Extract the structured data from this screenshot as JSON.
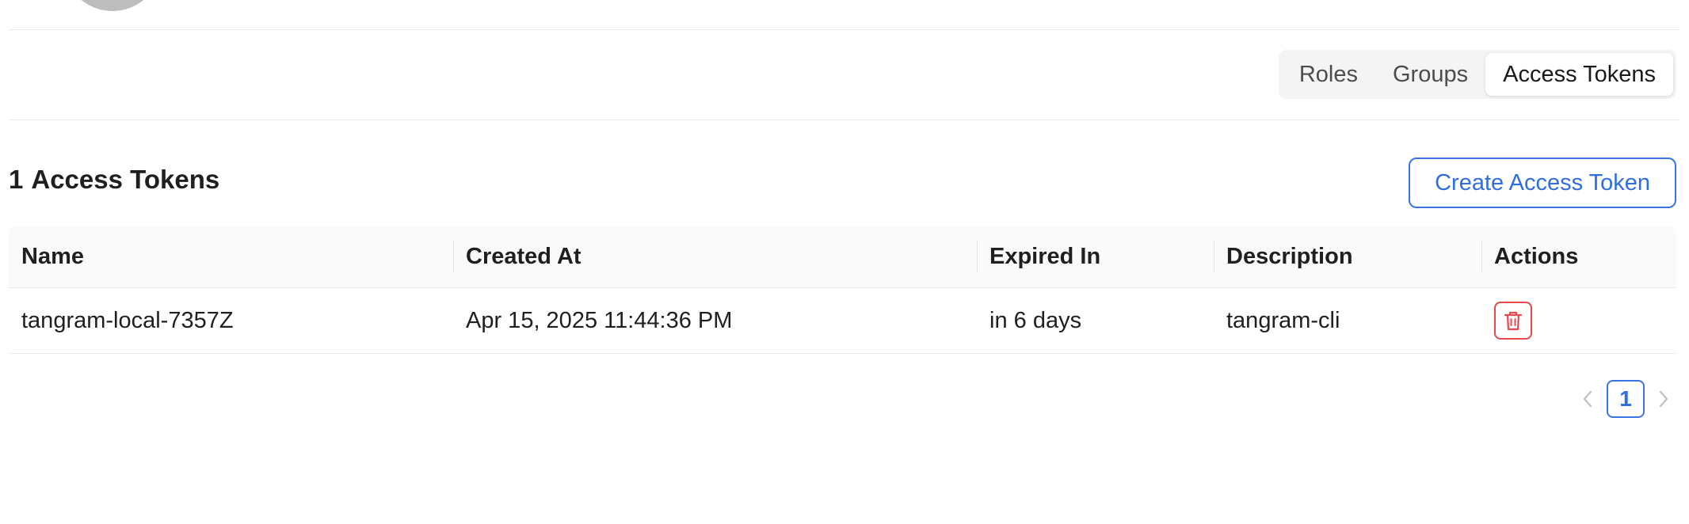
{
  "tabs": [
    {
      "label": "Roles",
      "active": false
    },
    {
      "label": "Groups",
      "active": false
    },
    {
      "label": "Access Tokens",
      "active": true
    }
  ],
  "section": {
    "count": "1",
    "title": "Access Tokens",
    "create_button_label": "Create Access Token"
  },
  "table": {
    "headers": {
      "name": "Name",
      "created_at": "Created At",
      "expired_in": "Expired In",
      "description": "Description",
      "actions": "Actions"
    },
    "rows": [
      {
        "name": "tangram-local-7357Z",
        "created_at": "Apr 15, 2025 11:44:36 PM",
        "expired_in": "in 6 days",
        "description": "tangram-cli",
        "action_icon": "trash-icon"
      }
    ]
  },
  "pagination": {
    "current_page": "1"
  },
  "colors": {
    "accent": "#2f6de2",
    "danger": "#e5484d",
    "avatar": "#bdbdbd"
  }
}
